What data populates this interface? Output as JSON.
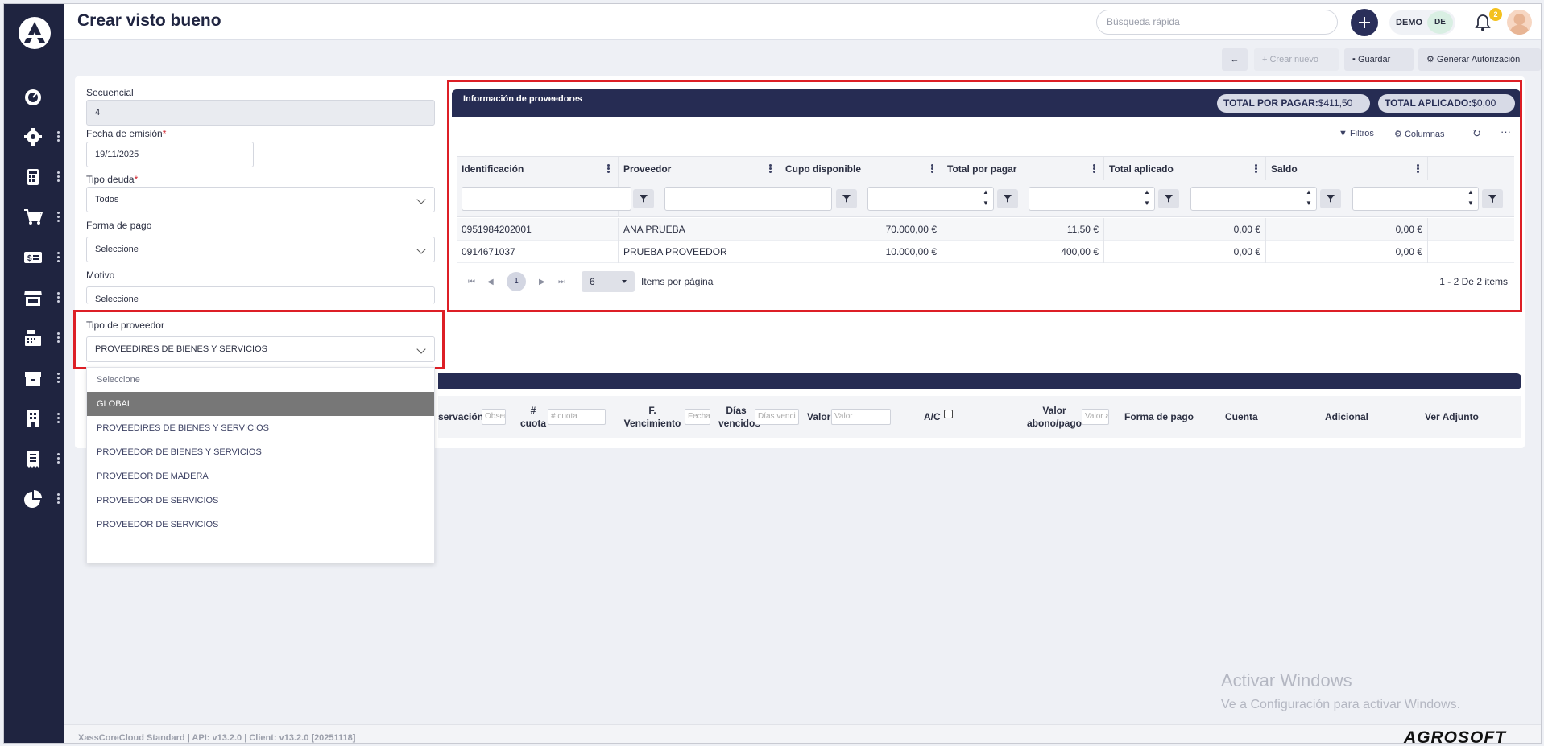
{
  "app": {
    "page_title": "Crear visto bueno",
    "search_placeholder": "Búsqueda rápida",
    "company_code": "DEMO",
    "company_badge": "DE",
    "notification_count": "2"
  },
  "sidebar": {
    "items": [
      {
        "icon": "dashboard-icon"
      },
      {
        "icon": "gear-icon"
      },
      {
        "icon": "calculator-icon"
      },
      {
        "icon": "cart-icon"
      },
      {
        "icon": "money-icon"
      },
      {
        "icon": "store-icon"
      },
      {
        "icon": "cash-register-icon"
      },
      {
        "icon": "box-icon"
      },
      {
        "icon": "building-icon"
      },
      {
        "icon": "receipt-icon"
      },
      {
        "icon": "pie-chart-icon"
      }
    ]
  },
  "actions": {
    "back": "←",
    "new_label": "Crear nuevo",
    "save_label": "Guardar",
    "authorize_label": "Generar Autorización"
  },
  "form": {
    "sequence_label": "Secuencial",
    "sequence_value": "4",
    "date_label": "Fecha de emisión",
    "date_value": "19/11/2025",
    "debt_type_label": "Tipo deuda",
    "debt_type_value": "Todos",
    "payment_label": "Forma de pago",
    "payment_value": "Seleccione",
    "reason_label": "Motivo",
    "reason_value": "Seleccione",
    "provider_type_label": "Tipo de proveedor",
    "provider_type_value": "PROVEEDIRES DE BIENES Y SERVICIOS",
    "required_mark": "*"
  },
  "dropdown": {
    "options": [
      "Seleccione",
      "GLOBAL",
      "PROVEEDIRES DE BIENES Y SERVICIOS",
      "PROVEEDOR DE BIENES Y SERVICIOS",
      "PROVEEDOR DE MADERA",
      "PROVEEDOR DE SERVICIOS",
      "PROVEEDOR DE SERVICIOS"
    ],
    "highlighted_index": 1
  },
  "providers_panel": {
    "title": "Información de proveedores",
    "total_to_pay_label": "TOTAL POR PAGAR:",
    "total_to_pay_value": "$411,50",
    "total_applied_label": "TOTAL APLICADO:",
    "total_applied_value": "$0,00",
    "filters_label": "Filtros",
    "columns_label": "Columnas",
    "columns": [
      "Identificación",
      "Proveedor",
      "Cupo disponible",
      "Total por pagar",
      "Total aplicado",
      "Saldo"
    ],
    "rows": [
      [
        "0951984202001",
        "ANA PRUEBA",
        "70.000,00 €",
        "11,50 €",
        "0,00 €",
        "0,00 €"
      ],
      [
        "0914671037",
        "PRUEBA PROVEEDOR",
        "10.000,00 €",
        "400,00 €",
        "0,00 €",
        "0,00 €"
      ]
    ],
    "pager": {
      "current_page": "1",
      "page_size": "6",
      "page_size_label": "Items por página",
      "summary": "1 - 2 De 2 items"
    }
  },
  "detail_table": {
    "headers": {
      "observation": "servación",
      "observation_placeholder": "Obser",
      "quota": "# cuota",
      "quota_placeholder": "# cuota",
      "due": "F. Vencimiento",
      "due_placeholder": "Fecha",
      "days": "Días vencidos",
      "days_placeholder": "Días venci",
      "value": "Valor",
      "value_placeholder": "Valor",
      "ac": "A/C",
      "payment_value": "Valor abono/pago",
      "payment_value_placeholder": "Valor a",
      "payment_method": "Forma de pago",
      "account": "Cuenta",
      "additional": "Adicional",
      "attachment": "Ver Adjunto"
    }
  },
  "watermark": {
    "line1": "Activar Windows",
    "line2": "Ve a Configuración para activar Windows."
  },
  "footer": {
    "version": "XassCoreCloud Standard | API: v13.2.0 | Client: v13.2.0 [20251118]",
    "brand": "AGROSOFT"
  }
}
